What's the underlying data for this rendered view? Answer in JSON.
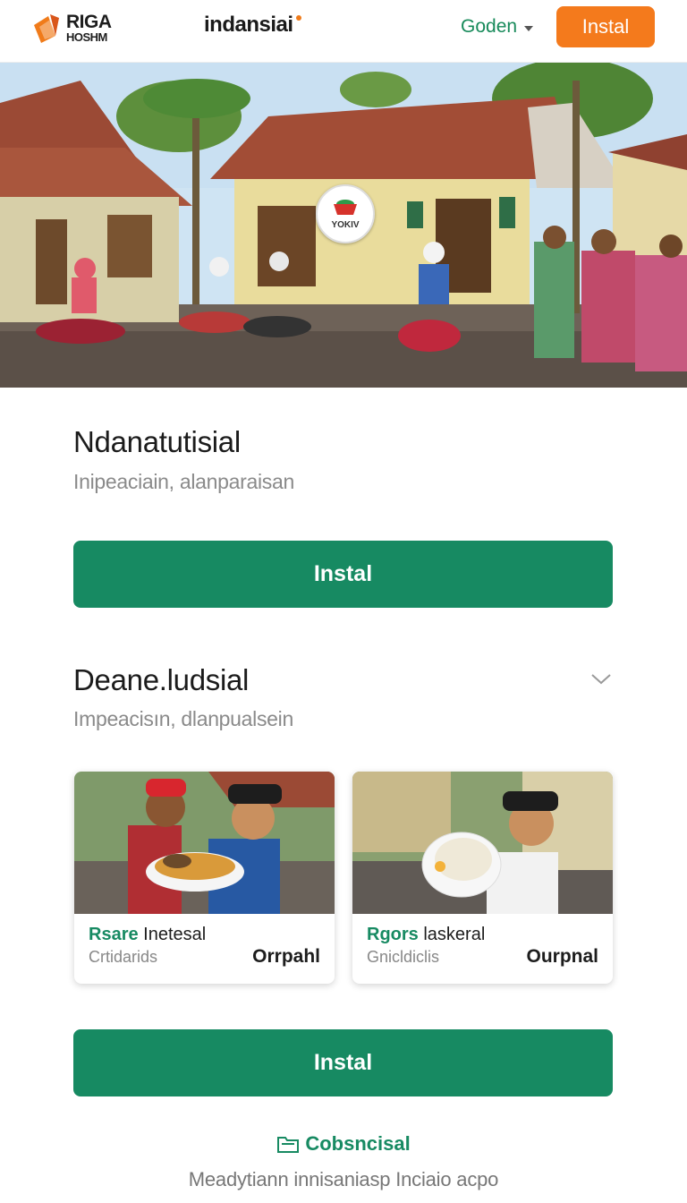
{
  "header": {
    "logo_line1": "RIGA",
    "logo_line2": "HOSHM",
    "brand": "indansiai",
    "language": "Goden",
    "install_label": "Instal"
  },
  "hero": {
    "badge_text": "YOKIV"
  },
  "section1": {
    "title": "Ndanatutisial",
    "subtitle": "Inipeaciain, alanparaisan",
    "button_label": "Instal"
  },
  "section2": {
    "title": "Deane.ludsial",
    "subtitle": "Impeacisın, dlanpualsein"
  },
  "cards": [
    {
      "title_accent": "Rsare",
      "title_rest": "Inetesal",
      "meta": "Crtidarids",
      "price": "Orrpahl"
    },
    {
      "title_accent": "Rgors",
      "title_rest": "laskeral",
      "meta": "Gnicldiclis",
      "price": "Ourpnal"
    }
  ],
  "bottom_button_label": "Instal",
  "footer": {
    "link_label": "Cobsncisal",
    "note": "Meadytiann innisaniasp Inciaio acpo"
  },
  "colors": {
    "accent_green": "#178a62",
    "accent_orange": "#f47a1c"
  },
  "icons": {
    "logo": "orange-book-logo",
    "dropdown": "caret-down-icon",
    "chevron": "chevron-down-icon",
    "footer_link": "folder-icon"
  }
}
